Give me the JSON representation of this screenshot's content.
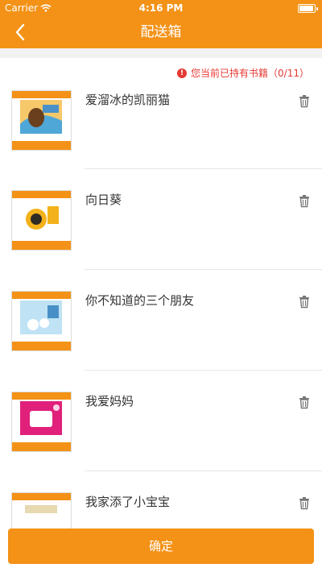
{
  "status_bar": {
    "carrier": "Carrier",
    "time": "4:16 PM"
  },
  "nav": {
    "title": "配送箱",
    "back_icon": "chevron-left-icon"
  },
  "notice": {
    "text": "您当前已持有书籍（0/11）",
    "color": "#e53935",
    "icon": "warning-icon"
  },
  "books": [
    {
      "title": "爱溜冰的凯丽猫",
      "cover_color": "#6a3f1d"
    },
    {
      "title": "向日葵",
      "cover_color": "#2f2a24"
    },
    {
      "title": "你不知道的三个朋友",
      "cover_color": "#4a90c8"
    },
    {
      "title": "我爱妈妈",
      "cover_color": "#e0207a"
    },
    {
      "title": "我家添了小宝宝",
      "cover_color": "#e7d9b0"
    }
  ],
  "footer": {
    "confirm_label": "确定"
  },
  "colors": {
    "accent": "#f39217"
  }
}
